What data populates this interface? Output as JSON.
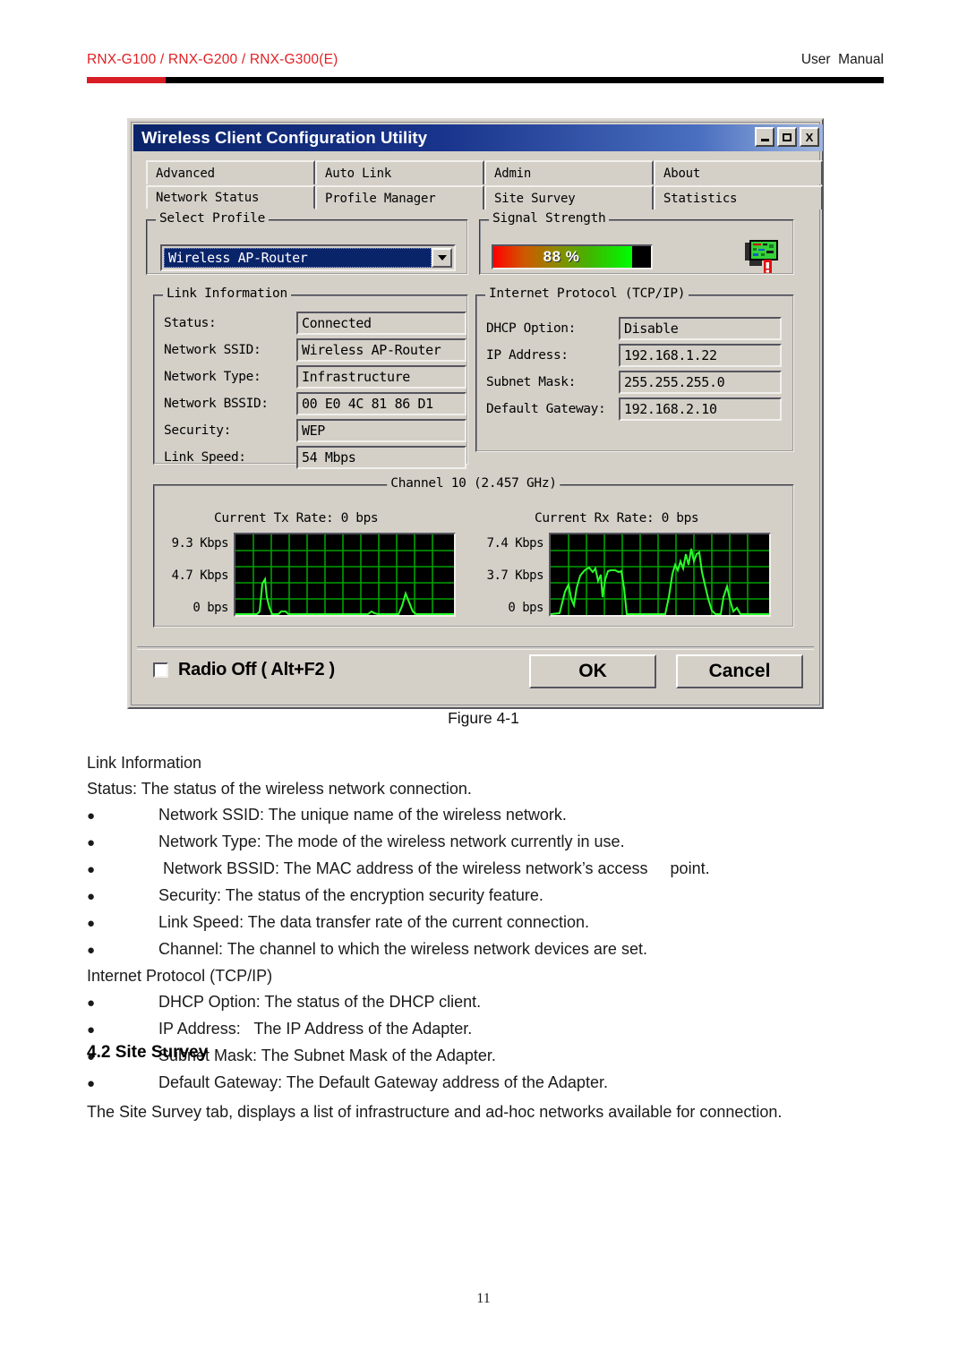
{
  "header": {
    "models": "RNX-G100 / RNX-G200 / RNX-G300(E)",
    "doc_type": "User  Manual",
    "accent_red": "#d81e24"
  },
  "dialog": {
    "title": "Wireless Client Configuration Utility",
    "titlebar_color": "#0a246a",
    "window_buttons": [
      {
        "name": "minimize",
        "glyph": "_"
      },
      {
        "name": "maximize",
        "glyph": "□"
      },
      {
        "name": "close",
        "glyph": "X"
      }
    ],
    "tabs_row1": [
      {
        "label": "Advanced"
      },
      {
        "label": "Auto Link"
      },
      {
        "label": "Admin"
      },
      {
        "label": "About"
      }
    ],
    "tabs_row2": [
      {
        "label": "Network Status",
        "selected": true
      },
      {
        "label": "Profile Manager",
        "selected": false
      },
      {
        "label": "Site Survey",
        "selected": false
      },
      {
        "label": "Statistics",
        "selected": false
      }
    ],
    "select_profile": {
      "legend": "Select Profile",
      "value": "Wireless AP-Router"
    },
    "signal_strength": {
      "legend": "Signal Strength",
      "percent_label": "88 %",
      "percent_value": 88
    },
    "link_information": {
      "legend": "Link Information",
      "rows": [
        {
          "label": "Status:",
          "value": "Connected"
        },
        {
          "label": "Network SSID:",
          "value": "Wireless AP-Router"
        },
        {
          "label": "Network Type:",
          "value": "Infrastructure"
        },
        {
          "label": "Network BSSID:",
          "value": "00 E0 4C 81 86 D1"
        },
        {
          "label": "Security:",
          "value": "WEP"
        },
        {
          "label": "Link Speed:",
          "value": "54 Mbps"
        }
      ]
    },
    "tcpip": {
      "legend": "Internet Protocol (TCP/IP)",
      "rows": [
        {
          "label": "DHCP Option:",
          "value": "Disable"
        },
        {
          "label": "IP Address:",
          "value": "192.168.1.22"
        },
        {
          "label": "Subnet Mask:",
          "value": "255.255.255.0"
        },
        {
          "label": "Default Gateway:",
          "value": "192.168.2.10"
        }
      ]
    },
    "channel": {
      "legend": "Channel 10 (2.457 GHz)",
      "tx": {
        "title": "Current Tx Rate: 0 bps",
        "axis": [
          "9.3 Kbps",
          "4.7 Kbps",
          "0 bps"
        ]
      },
      "rx": {
        "title": "Current Rx Rate: 0 bps",
        "axis": [
          "7.4 Kbps",
          "3.7 Kbps",
          "0 bps"
        ]
      }
    },
    "radio_off": {
      "label": "Radio Off ( Alt+F2 )",
      "checked": false
    },
    "ok_label": "OK",
    "cancel_label": "Cancel"
  },
  "figure_caption": "Figure 4-1",
  "body": {
    "lines": [
      {
        "type": "plain",
        "text": "Link Information"
      },
      {
        "type": "plain",
        "text": "Status: The status of the wireless network connection."
      },
      {
        "type": "bullet",
        "text": "Network SSID: The unique name of the wireless network."
      },
      {
        "type": "bullet",
        "text": "Network Type: The mode of the wireless network currently in use."
      },
      {
        "type": "bullet",
        "text": " Network BSSID: The MAC address of the wireless network’s access     point."
      },
      {
        "type": "bullet",
        "text": "Security: The status of the encryption security feature."
      },
      {
        "type": "bullet",
        "text": "Link Speed: The data transfer rate of the current connection."
      },
      {
        "type": "bullet",
        "text": "Channel: The channel to which the wireless network devices are set."
      },
      {
        "type": "plain",
        "text": "Internet Protocol (TCP/IP)"
      },
      {
        "type": "bullet",
        "text": "DHCP Option: The status of the DHCP client."
      },
      {
        "type": "bullet",
        "text": "IP Address:   The IP Address of the Adapter."
      },
      {
        "type": "bullet",
        "text": "Subnet Mask: The Subnet Mask of the Adapter."
      },
      {
        "type": "bullet",
        "text": "Default Gateway: The Default Gateway address of the Adapter."
      }
    ],
    "bullet_glyph": "●"
  },
  "section": {
    "heading": "4.2 Site Survey",
    "paragraph": "The Site Survey tab, displays a list of infrastructure and ad-hoc networks available for connection."
  },
  "page_number": "11"
}
